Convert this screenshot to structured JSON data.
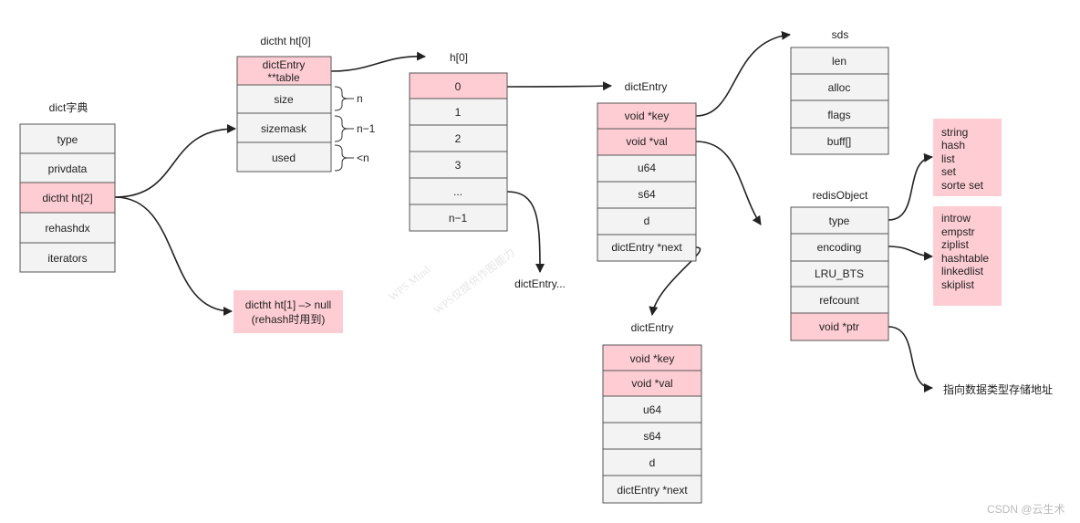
{
  "dict": {
    "title": "dict字典",
    "fields": [
      "type",
      "privdata",
      "dictht ht[2]",
      "rehashdx",
      "iterators"
    ],
    "highlight": [
      2
    ]
  },
  "dictht0": {
    "title": "dictht ht[0]",
    "fields": [
      "dictEntry",
      "**table",
      "size",
      "sizemask",
      "used"
    ],
    "brace_labels": [
      "n",
      "n−1",
      "<n"
    ]
  },
  "ht1_note": {
    "line1": "dictht ht[1] –> null",
    "line2": "(rehash时用到)"
  },
  "h0": {
    "title": "h[0]",
    "fields": [
      "0",
      "1",
      "2",
      "3",
      "...",
      "n−1"
    ],
    "more_label": "dictEntry..."
  },
  "entry1": {
    "title": "dictEntry",
    "fields": [
      "void *key",
      "void *val",
      "u64",
      "s64",
      "d",
      "dictEntry *next"
    ]
  },
  "entry2": {
    "title": "dictEntry",
    "fields": [
      "void *key",
      "void *val",
      "u64",
      "s64",
      "d",
      "dictEntry *next"
    ]
  },
  "sds": {
    "title": "sds",
    "fields": [
      "len",
      "alloc",
      "flags",
      "buff[]"
    ]
  },
  "redisObject": {
    "title": "redisObject",
    "fields": [
      "type",
      "encoding",
      "LRU_BTS",
      "refcount",
      "void *ptr"
    ]
  },
  "types": [
    "string",
    "hash",
    "list",
    "set",
    "sorte set"
  ],
  "encodings": [
    "introw",
    "empstr",
    "ziplist",
    "hashtable",
    "linkedlist",
    "skiplist"
  ],
  "ptr_note": "指向数据类型存储地址",
  "watermark": {
    "line1": "WPS Mind",
    "line2": "WPS仅提供作图能力",
    "csdn": "CSDN @云生术"
  },
  "colors": {
    "highlight": "#fecdd3",
    "cell": "#f3f3f3",
    "border": "#555555"
  }
}
